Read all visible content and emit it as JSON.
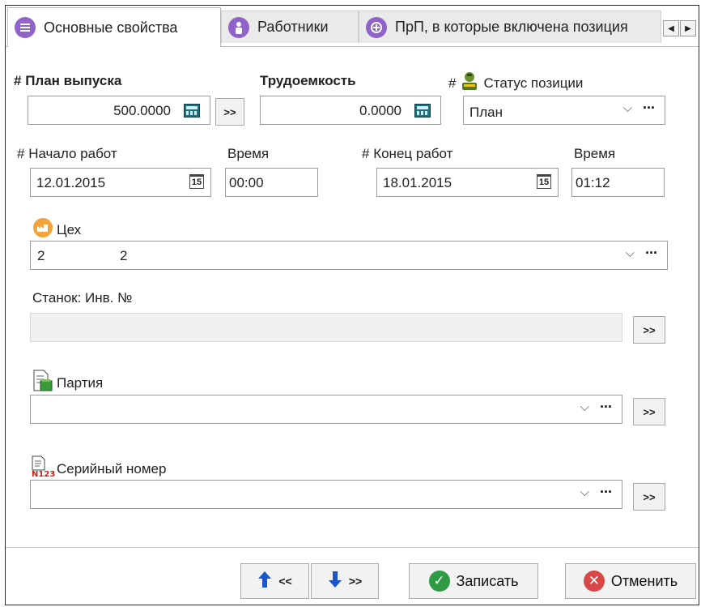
{
  "tabs": [
    {
      "label": "Основные свойства",
      "icon": "list-icon"
    },
    {
      "label": "Работники",
      "icon": "person-icon"
    },
    {
      "label": "ПрП, в которые включена позиция",
      "icon": "workflow-icon"
    }
  ],
  "tab_scroll": {
    "left": "◀",
    "right": "▶"
  },
  "plan": {
    "label": "План выпуска",
    "marker": "#",
    "value": "500.0000"
  },
  "labor": {
    "label": "Трудоемкость",
    "value": "0.0000"
  },
  "status": {
    "label": "Статус позиции",
    "marker": "#",
    "value": "План",
    "icon": "worker-icon"
  },
  "start": {
    "label": "Начало работ",
    "marker": "#",
    "date": "12.01.2015",
    "time_label": "Время",
    "time": "00:00"
  },
  "end": {
    "label": "Конец работ",
    "marker": "#",
    "date": "18.01.2015",
    "time_label": "Время",
    "time": "01:12"
  },
  "calendar_day": "15",
  "workshop": {
    "label": "Цех",
    "code": "2",
    "name": "2",
    "icon": "factory-icon"
  },
  "machine": {
    "label": "Станок: Инв. №",
    "value": ""
  },
  "batch": {
    "label": "Партия",
    "value": "",
    "icon": "batch-doc-icon"
  },
  "serial": {
    "label": "Серийный номер",
    "value": "",
    "icon": "serial-doc-icon"
  },
  "controls": {
    "go": ">>",
    "dots": "···",
    "dropdown": "⌵"
  },
  "buttons": {
    "prev": "<<",
    "next": ">>",
    "save": "Записать",
    "cancel": "Отменить"
  },
  "colors": {
    "save": "#2e9a44",
    "cancel": "#d94848",
    "arrow": "#1a56c9",
    "tab_icon": "#8f63c7"
  }
}
